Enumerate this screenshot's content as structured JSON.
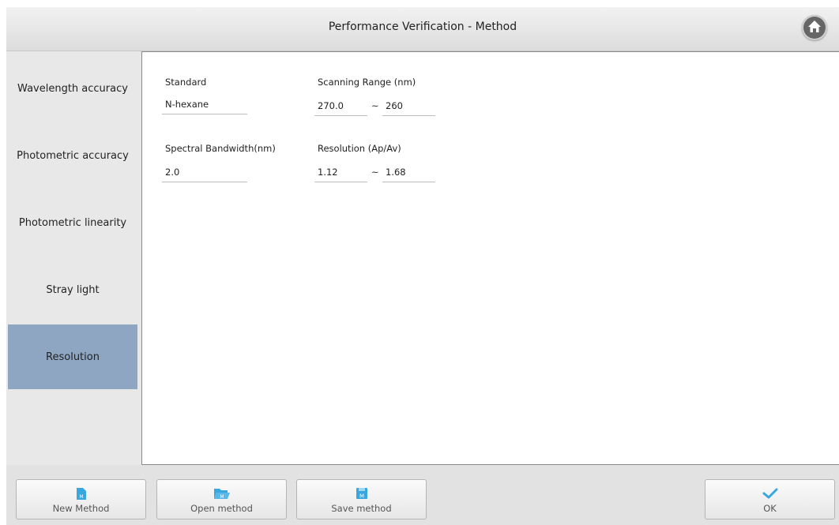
{
  "window": {
    "title": "Performance Verification - Method"
  },
  "sidebar": {
    "items": [
      {
        "label": "Wavelength accuracy"
      },
      {
        "label": "Photometric accuracy"
      },
      {
        "label": "Photometric linearity"
      },
      {
        "label": "Stray light"
      },
      {
        "label": "Resolution",
        "active": true
      }
    ]
  },
  "form": {
    "standard_label": "Standard",
    "standard_value": "N-hexane",
    "scan_range_label": "Scanning Range (nm)",
    "scan_range_from": "270.0",
    "scan_range_to": "260",
    "bandwidth_label": "Spectral Bandwidth(nm)",
    "bandwidth_value": "2.0",
    "resolution_label": "Resolution (Ap/Av)",
    "resolution_from": "1.12",
    "resolution_to": "1.68",
    "range_separator": "~"
  },
  "toolbar": {
    "new_method": "New Method",
    "open_method": "Open method",
    "save_method": "Save method",
    "ok": "OK"
  },
  "colors": {
    "active_tab": "#8ea6c2",
    "icon_blue": "#38a6df"
  }
}
